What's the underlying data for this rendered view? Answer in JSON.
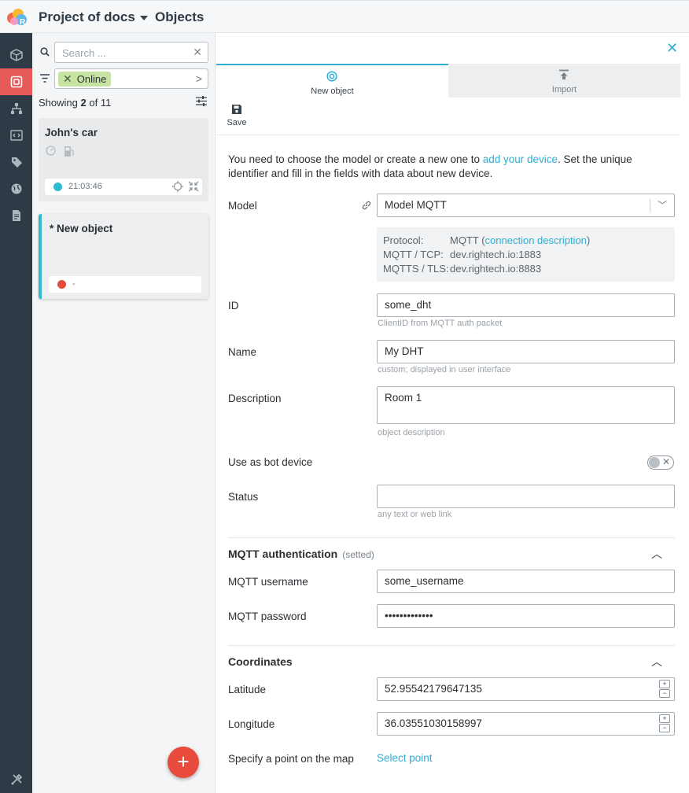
{
  "header": {
    "project": "Project of docs",
    "section": "Objects"
  },
  "rail": {
    "items": [
      "cube-icon",
      "objects-icon",
      "hierarchy-icon",
      "code-icon",
      "tag-icon",
      "globe-icon",
      "document-icon"
    ],
    "bottom": "tools-icon",
    "active_index": 1,
    "active_color": "#e65a5a"
  },
  "list": {
    "search_placeholder": "Search ...",
    "filter_chip": "Online",
    "showing_prefix": "Showing",
    "showing_count": "2",
    "showing_of": "of",
    "showing_total": "11",
    "items": [
      {
        "title": "John's car",
        "time": "21:03:46",
        "status_color": "#2ebad0"
      },
      {
        "title": "* New object",
        "time": "-",
        "status_color": "#e84b3c"
      }
    ],
    "add_button": "+"
  },
  "main": {
    "close": "✕",
    "tabs": [
      {
        "label": "New object",
        "icon": "target-icon"
      },
      {
        "label": "Import",
        "icon": "upload-icon"
      }
    ],
    "save_label": "Save",
    "intro_before": "You need to choose the model or create a new one to ",
    "intro_link": "add your device",
    "intro_after": ". Set the unique identifier and fill in the fields with data about new device.",
    "fields": {
      "model_label": "Model",
      "model_value": "Model MQTT",
      "protocol": {
        "protocol_key": "Protocol:",
        "protocol_value": "MQTT",
        "protocol_link": "connection description",
        "tcp_key": "MQTT / TCP:",
        "tcp_value": "dev.rightech.io:1883",
        "tls_key": "MQTTS / TLS:",
        "tls_value": "dev.rightech.io:8883"
      },
      "id_label": "ID",
      "id_value": "some_dht",
      "id_hint": "ClientID from MQTT auth packet",
      "name_label": "Name",
      "name_value": "My DHT",
      "name_hint": "custom; displayed in user interface",
      "description_label": "Description",
      "description_value": "Room 1",
      "description_hint": "object description",
      "bot_label": "Use as bot device",
      "bot_enabled": false,
      "status_label": "Status",
      "status_value": "",
      "status_hint": "any text or web link"
    },
    "mqtt": {
      "title": "MQTT authentication",
      "subtitle": "(setted)",
      "username_label": "MQTT username",
      "username_value": "some_username",
      "password_label": "MQTT password",
      "password_value": "•••••••••••••"
    },
    "coordinates": {
      "title": "Coordinates",
      "latitude_label": "Latitude",
      "latitude_value": "52.95542179647135",
      "longitude_label": "Longitude",
      "longitude_value": "36.03551030158997",
      "map_label": "Specify a point on the map",
      "map_link": "Select point"
    },
    "accent_color": "#2eaed4"
  }
}
